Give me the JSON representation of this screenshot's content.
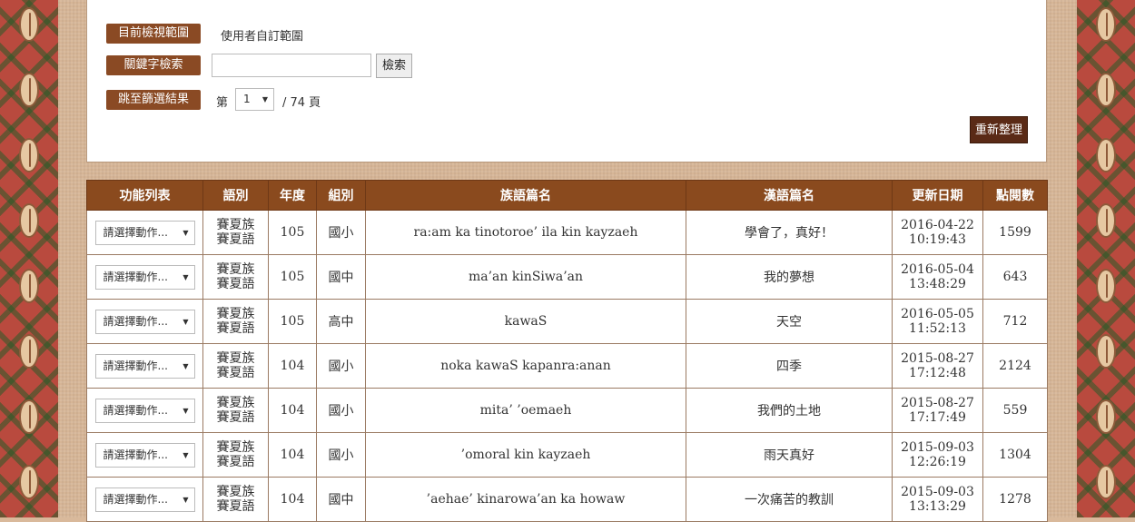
{
  "filter": {
    "view_scope_label": "目前檢視範圍",
    "view_scope_value": "使用者自訂範圍",
    "keyword_label": "關鍵字檢索",
    "keyword_value": "",
    "search_button": "檢索",
    "jump_label": "跳至篩選結果",
    "page_prefix": "第",
    "page_selected": "1",
    "page_total": "/ 74 頁",
    "reorganize_button": "重新整理"
  },
  "table": {
    "headers": [
      "功能列表",
      "語別",
      "年度",
      "組別",
      "族語篇名",
      "漢語篇名",
      "更新日期",
      "點閱數"
    ],
    "rows": [
      {
        "action": "請選擇動作...",
        "lang1": "賽夏族",
        "lang2": "賽夏語",
        "year": "105",
        "group": "國小",
        "title": "ra:am ka tinotoroe’ ila kin kayzaeh",
        "zh_title": "學會了，真好！",
        "date": "2016-04-22",
        "time": "10:19:43",
        "views": "1599"
      },
      {
        "action": "請選擇動作...",
        "lang1": "賽夏族",
        "lang2": "賽夏語",
        "year": "105",
        "group": "國中",
        "title": "ma’an kinSiwa’an",
        "zh_title": "我的夢想",
        "date": "2016-05-04",
        "time": "13:48:29",
        "views": "643"
      },
      {
        "action": "請選擇動作...",
        "lang1": "賽夏族",
        "lang2": "賽夏語",
        "year": "105",
        "group": "高中",
        "title": "kawaS",
        "zh_title": "天空",
        "date": "2016-05-05",
        "time": "11:52:13",
        "views": "712"
      },
      {
        "action": "請選擇動作...",
        "lang1": "賽夏族",
        "lang2": "賽夏語",
        "year": "104",
        "group": "國小",
        "title": "noka kawaS kapanra:anan",
        "zh_title": "四季",
        "date": "2015-08-27",
        "time": "17:12:48",
        "views": "2124"
      },
      {
        "action": "請選擇動作...",
        "lang1": "賽夏族",
        "lang2": "賽夏語",
        "year": "104",
        "group": "國小",
        "title": "mita’ ’oemaeh",
        "zh_title": "我們的土地",
        "date": "2015-08-27",
        "time": "17:17:49",
        "views": "559"
      },
      {
        "action": "請選擇動作...",
        "lang1": "賽夏族",
        "lang2": "賽夏語",
        "year": "104",
        "group": "國小",
        "title": "’omoral kin kayzaeh",
        "zh_title": "雨天真好",
        "date": "2015-09-03",
        "time": "12:26:19",
        "views": "1304"
      },
      {
        "action": "請選擇動作...",
        "lang1": "賽夏族",
        "lang2": "賽夏語",
        "year": "104",
        "group": "國中",
        "title": "’aehae’ kinarowa’an ka howaw",
        "zh_title": "一次痛苦的教訓",
        "date": "2015-09-03",
        "time": "13:13:29",
        "views": "1278"
      }
    ]
  },
  "colors": {
    "header_brown": "#8a4a1e",
    "label_brown": "#8a4a24",
    "button_dark": "#5a2a16"
  }
}
